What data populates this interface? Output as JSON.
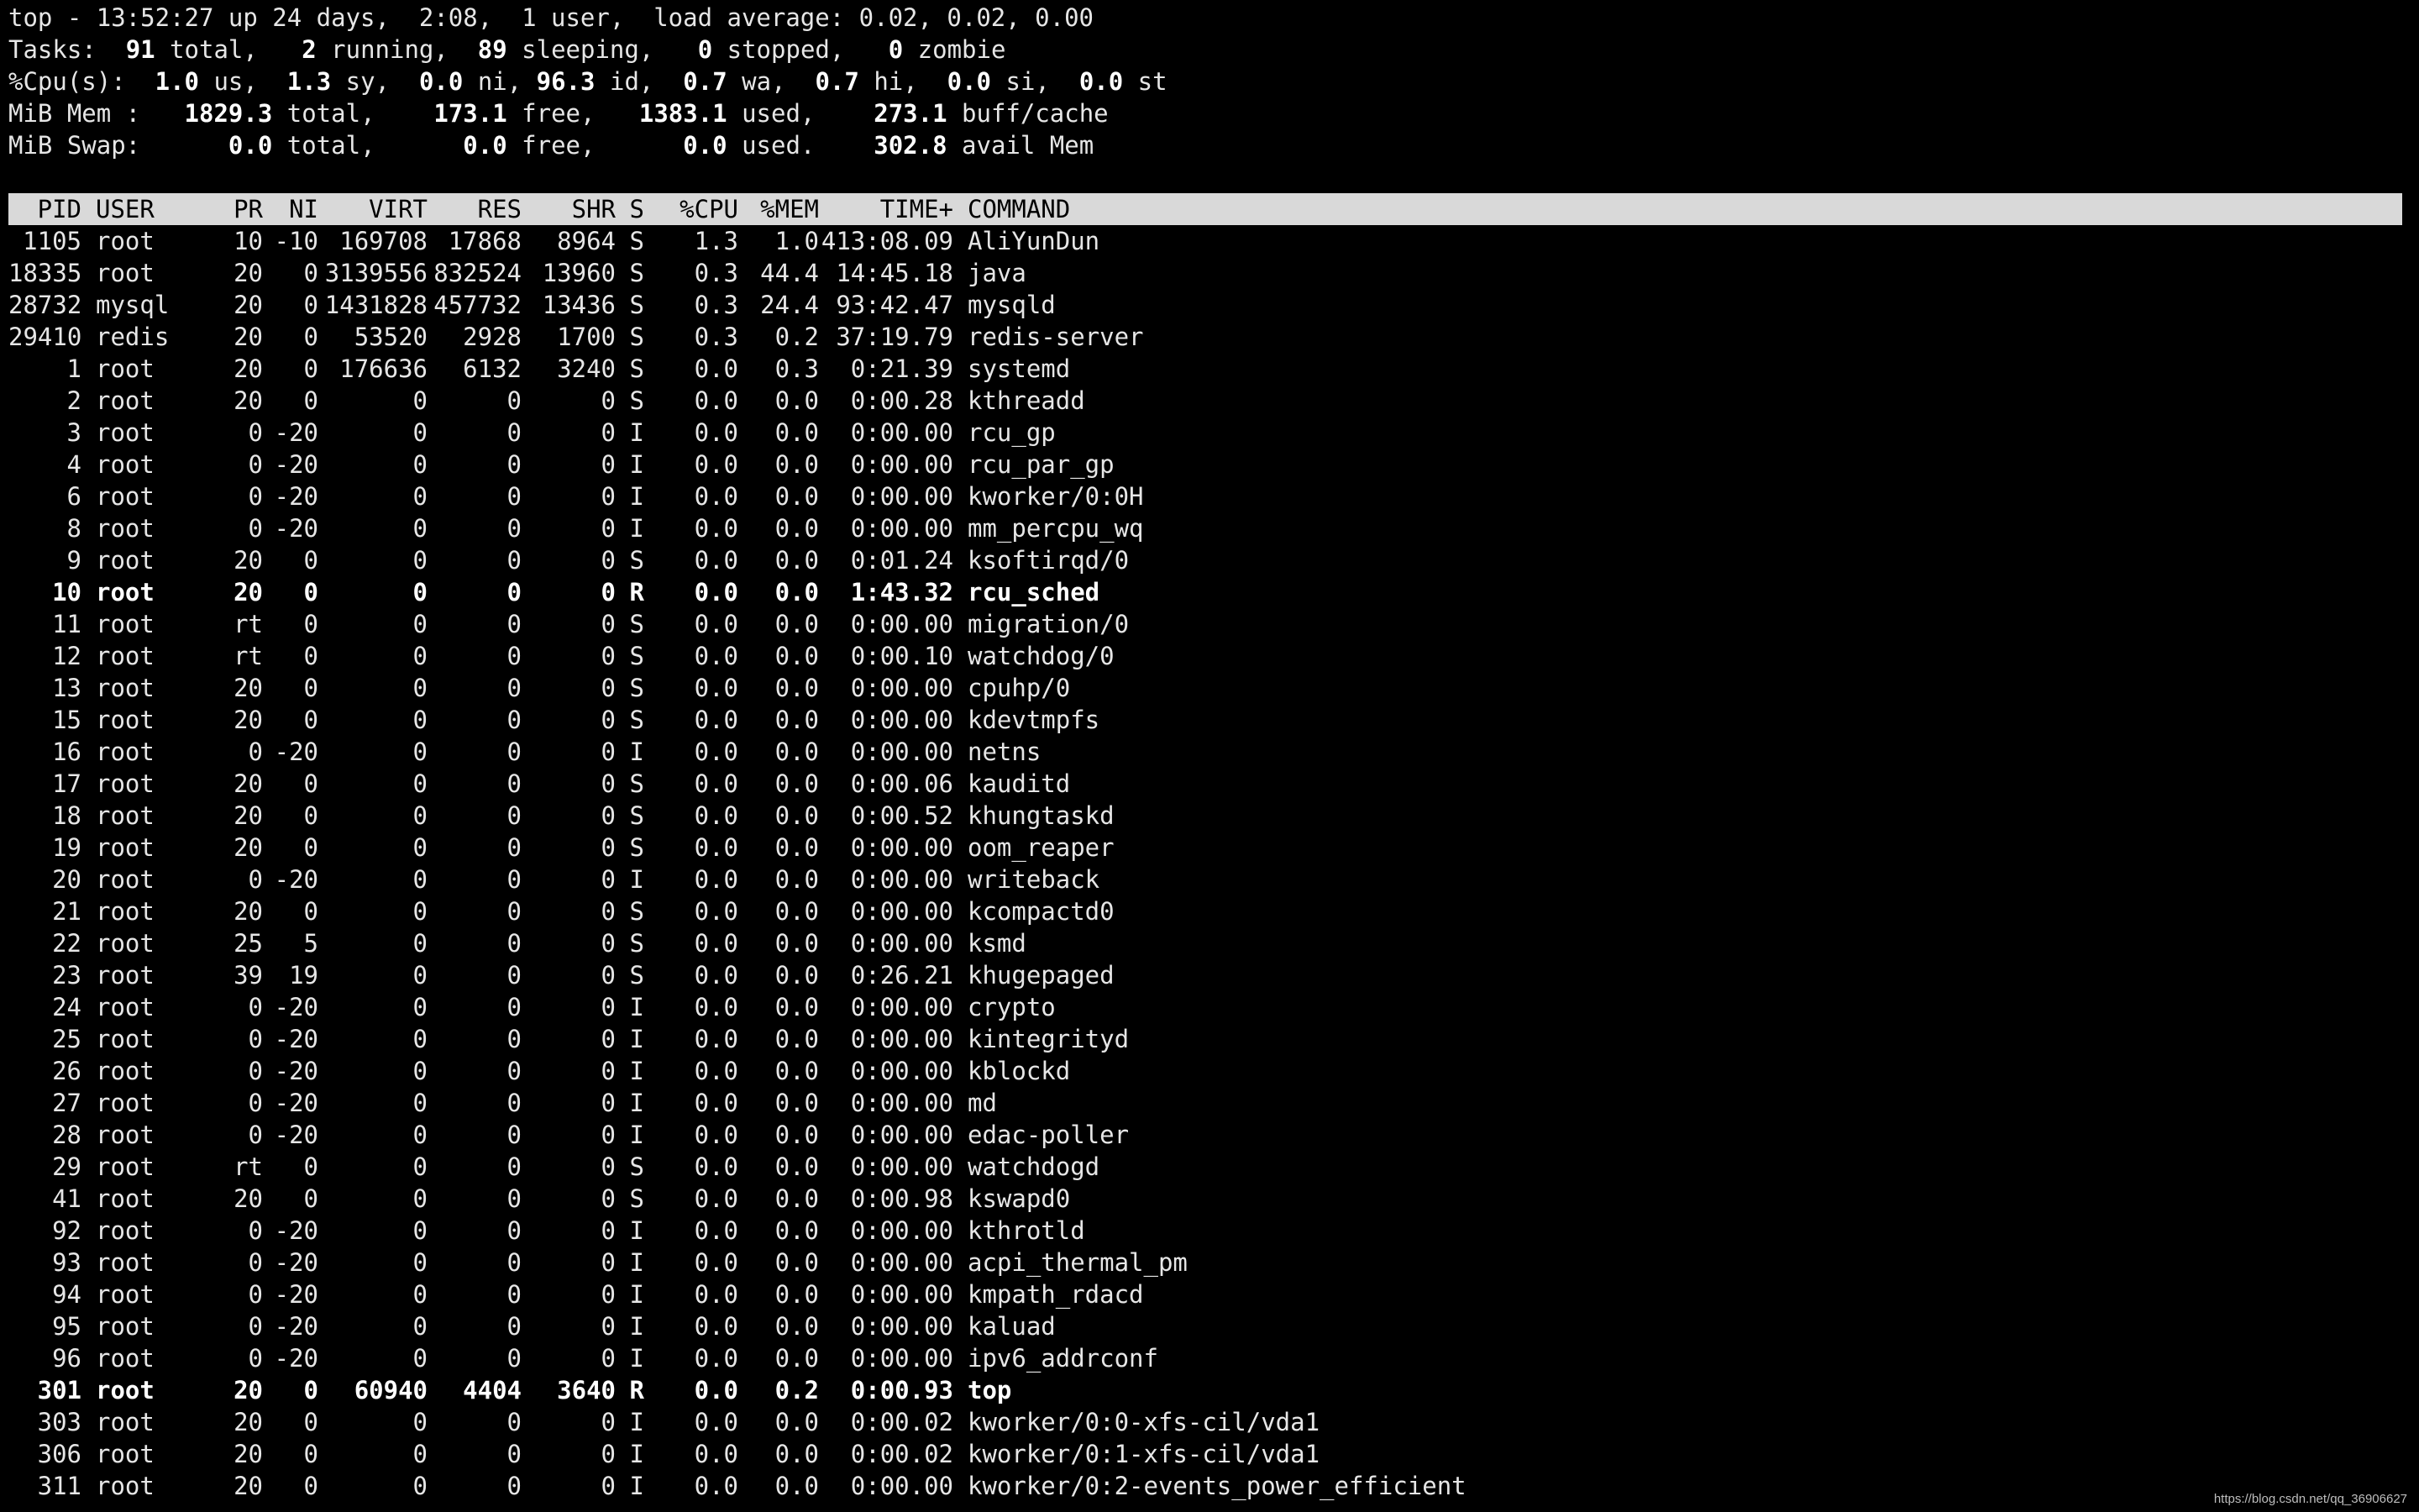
{
  "summary": {
    "uptime_line": "top - 13:52:27 up 24 days,  2:08,  1 user,  load average: 0.02, 0.02, 0.00",
    "tasks": {
      "label": "Tasks:",
      "total": "91",
      "total_label": "total,",
      "running": "2",
      "running_label": "running,",
      "sleeping": "89",
      "sleeping_label": "sleeping,",
      "stopped": "0",
      "stopped_label": "stopped,",
      "zombie": "0",
      "zombie_label": "zombie"
    },
    "cpu": {
      "label": "%Cpu(s):",
      "us": "1.0",
      "us_label": "us,",
      "sy": "1.3",
      "sy_label": "sy,",
      "ni": "0.0",
      "ni_label": "ni,",
      "id": "96.3",
      "id_label": "id,",
      "wa": "0.7",
      "wa_label": "wa,",
      "hi": "0.7",
      "hi_label": "hi,",
      "si": "0.0",
      "si_label": "si,",
      "st": "0.0",
      "st_label": "st"
    },
    "mem": {
      "label": "MiB Mem :",
      "total": "1829.3",
      "total_label": "total,",
      "free": "173.1",
      "free_label": "free,",
      "used": "1383.1",
      "used_label": "used,",
      "buff": "273.1",
      "buff_label": "buff/cache"
    },
    "swap": {
      "label": "MiB Swap:",
      "total": "0.0",
      "total_label": "total,",
      "free": "0.0",
      "free_label": "free,",
      "used": "0.0",
      "used_label": "used.",
      "avail": "302.8",
      "avail_label": "avail Mem"
    }
  },
  "table": {
    "columns": {
      "pid": "PID",
      "user": "USER",
      "pr": "PR",
      "ni": "NI",
      "virt": "VIRT",
      "res": "RES",
      "shr": "SHR",
      "s": "S",
      "cpu": "%CPU",
      "mem": "%MEM",
      "time": "TIME+",
      "command": "COMMAND"
    },
    "rows": [
      {
        "pid": "1105",
        "user": "root",
        "pr": "10",
        "ni": "-10",
        "virt": "169708",
        "res": "17868",
        "shr": "8964",
        "s": "S",
        "cpu": "1.3",
        "mem": "1.0",
        "time": "413:08.09",
        "command": "AliYunDun",
        "bold": false
      },
      {
        "pid": "18335",
        "user": "root",
        "pr": "20",
        "ni": "0",
        "virt": "3139556",
        "res": "832524",
        "shr": "13960",
        "s": "S",
        "cpu": "0.3",
        "mem": "44.4",
        "time": "14:45.18",
        "command": "java",
        "bold": false
      },
      {
        "pid": "28732",
        "user": "mysql",
        "pr": "20",
        "ni": "0",
        "virt": "1431828",
        "res": "457732",
        "shr": "13436",
        "s": "S",
        "cpu": "0.3",
        "mem": "24.4",
        "time": "93:42.47",
        "command": "mysqld",
        "bold": false
      },
      {
        "pid": "29410",
        "user": "redis",
        "pr": "20",
        "ni": "0",
        "virt": "53520",
        "res": "2928",
        "shr": "1700",
        "s": "S",
        "cpu": "0.3",
        "mem": "0.2",
        "time": "37:19.79",
        "command": "redis-server",
        "bold": false
      },
      {
        "pid": "1",
        "user": "root",
        "pr": "20",
        "ni": "0",
        "virt": "176636",
        "res": "6132",
        "shr": "3240",
        "s": "S",
        "cpu": "0.0",
        "mem": "0.3",
        "time": "0:21.39",
        "command": "systemd",
        "bold": false
      },
      {
        "pid": "2",
        "user": "root",
        "pr": "20",
        "ni": "0",
        "virt": "0",
        "res": "0",
        "shr": "0",
        "s": "S",
        "cpu": "0.0",
        "mem": "0.0",
        "time": "0:00.28",
        "command": "kthreadd",
        "bold": false
      },
      {
        "pid": "3",
        "user": "root",
        "pr": "0",
        "ni": "-20",
        "virt": "0",
        "res": "0",
        "shr": "0",
        "s": "I",
        "cpu": "0.0",
        "mem": "0.0",
        "time": "0:00.00",
        "command": "rcu_gp",
        "bold": false
      },
      {
        "pid": "4",
        "user": "root",
        "pr": "0",
        "ni": "-20",
        "virt": "0",
        "res": "0",
        "shr": "0",
        "s": "I",
        "cpu": "0.0",
        "mem": "0.0",
        "time": "0:00.00",
        "command": "rcu_par_gp",
        "bold": false
      },
      {
        "pid": "6",
        "user": "root",
        "pr": "0",
        "ni": "-20",
        "virt": "0",
        "res": "0",
        "shr": "0",
        "s": "I",
        "cpu": "0.0",
        "mem": "0.0",
        "time": "0:00.00",
        "command": "kworker/0:0H",
        "bold": false
      },
      {
        "pid": "8",
        "user": "root",
        "pr": "0",
        "ni": "-20",
        "virt": "0",
        "res": "0",
        "shr": "0",
        "s": "I",
        "cpu": "0.0",
        "mem": "0.0",
        "time": "0:00.00",
        "command": "mm_percpu_wq",
        "bold": false
      },
      {
        "pid": "9",
        "user": "root",
        "pr": "20",
        "ni": "0",
        "virt": "0",
        "res": "0",
        "shr": "0",
        "s": "S",
        "cpu": "0.0",
        "mem": "0.0",
        "time": "0:01.24",
        "command": "ksoftirqd/0",
        "bold": false
      },
      {
        "pid": "10",
        "user": "root",
        "pr": "20",
        "ni": "0",
        "virt": "0",
        "res": "0",
        "shr": "0",
        "s": "R",
        "cpu": "0.0",
        "mem": "0.0",
        "time": "1:43.32",
        "command": "rcu_sched",
        "bold": true
      },
      {
        "pid": "11",
        "user": "root",
        "pr": "rt",
        "ni": "0",
        "virt": "0",
        "res": "0",
        "shr": "0",
        "s": "S",
        "cpu": "0.0",
        "mem": "0.0",
        "time": "0:00.00",
        "command": "migration/0",
        "bold": false
      },
      {
        "pid": "12",
        "user": "root",
        "pr": "rt",
        "ni": "0",
        "virt": "0",
        "res": "0",
        "shr": "0",
        "s": "S",
        "cpu": "0.0",
        "mem": "0.0",
        "time": "0:00.10",
        "command": "watchdog/0",
        "bold": false
      },
      {
        "pid": "13",
        "user": "root",
        "pr": "20",
        "ni": "0",
        "virt": "0",
        "res": "0",
        "shr": "0",
        "s": "S",
        "cpu": "0.0",
        "mem": "0.0",
        "time": "0:00.00",
        "command": "cpuhp/0",
        "bold": false
      },
      {
        "pid": "15",
        "user": "root",
        "pr": "20",
        "ni": "0",
        "virt": "0",
        "res": "0",
        "shr": "0",
        "s": "S",
        "cpu": "0.0",
        "mem": "0.0",
        "time": "0:00.00",
        "command": "kdevtmpfs",
        "bold": false
      },
      {
        "pid": "16",
        "user": "root",
        "pr": "0",
        "ni": "-20",
        "virt": "0",
        "res": "0",
        "shr": "0",
        "s": "I",
        "cpu": "0.0",
        "mem": "0.0",
        "time": "0:00.00",
        "command": "netns",
        "bold": false
      },
      {
        "pid": "17",
        "user": "root",
        "pr": "20",
        "ni": "0",
        "virt": "0",
        "res": "0",
        "shr": "0",
        "s": "S",
        "cpu": "0.0",
        "mem": "0.0",
        "time": "0:00.06",
        "command": "kauditd",
        "bold": false
      },
      {
        "pid": "18",
        "user": "root",
        "pr": "20",
        "ni": "0",
        "virt": "0",
        "res": "0",
        "shr": "0",
        "s": "S",
        "cpu": "0.0",
        "mem": "0.0",
        "time": "0:00.52",
        "command": "khungtaskd",
        "bold": false
      },
      {
        "pid": "19",
        "user": "root",
        "pr": "20",
        "ni": "0",
        "virt": "0",
        "res": "0",
        "shr": "0",
        "s": "S",
        "cpu": "0.0",
        "mem": "0.0",
        "time": "0:00.00",
        "command": "oom_reaper",
        "bold": false
      },
      {
        "pid": "20",
        "user": "root",
        "pr": "0",
        "ni": "-20",
        "virt": "0",
        "res": "0",
        "shr": "0",
        "s": "I",
        "cpu": "0.0",
        "mem": "0.0",
        "time": "0:00.00",
        "command": "writeback",
        "bold": false
      },
      {
        "pid": "21",
        "user": "root",
        "pr": "20",
        "ni": "0",
        "virt": "0",
        "res": "0",
        "shr": "0",
        "s": "S",
        "cpu": "0.0",
        "mem": "0.0",
        "time": "0:00.00",
        "command": "kcompactd0",
        "bold": false
      },
      {
        "pid": "22",
        "user": "root",
        "pr": "25",
        "ni": "5",
        "virt": "0",
        "res": "0",
        "shr": "0",
        "s": "S",
        "cpu": "0.0",
        "mem": "0.0",
        "time": "0:00.00",
        "command": "ksmd",
        "bold": false
      },
      {
        "pid": "23",
        "user": "root",
        "pr": "39",
        "ni": "19",
        "virt": "0",
        "res": "0",
        "shr": "0",
        "s": "S",
        "cpu": "0.0",
        "mem": "0.0",
        "time": "0:26.21",
        "command": "khugepaged",
        "bold": false
      },
      {
        "pid": "24",
        "user": "root",
        "pr": "0",
        "ni": "-20",
        "virt": "0",
        "res": "0",
        "shr": "0",
        "s": "I",
        "cpu": "0.0",
        "mem": "0.0",
        "time": "0:00.00",
        "command": "crypto",
        "bold": false
      },
      {
        "pid": "25",
        "user": "root",
        "pr": "0",
        "ni": "-20",
        "virt": "0",
        "res": "0",
        "shr": "0",
        "s": "I",
        "cpu": "0.0",
        "mem": "0.0",
        "time": "0:00.00",
        "command": "kintegrityd",
        "bold": false
      },
      {
        "pid": "26",
        "user": "root",
        "pr": "0",
        "ni": "-20",
        "virt": "0",
        "res": "0",
        "shr": "0",
        "s": "I",
        "cpu": "0.0",
        "mem": "0.0",
        "time": "0:00.00",
        "command": "kblockd",
        "bold": false
      },
      {
        "pid": "27",
        "user": "root",
        "pr": "0",
        "ni": "-20",
        "virt": "0",
        "res": "0",
        "shr": "0",
        "s": "I",
        "cpu": "0.0",
        "mem": "0.0",
        "time": "0:00.00",
        "command": "md",
        "bold": false
      },
      {
        "pid": "28",
        "user": "root",
        "pr": "0",
        "ni": "-20",
        "virt": "0",
        "res": "0",
        "shr": "0",
        "s": "I",
        "cpu": "0.0",
        "mem": "0.0",
        "time": "0:00.00",
        "command": "edac-poller",
        "bold": false
      },
      {
        "pid": "29",
        "user": "root",
        "pr": "rt",
        "ni": "0",
        "virt": "0",
        "res": "0",
        "shr": "0",
        "s": "S",
        "cpu": "0.0",
        "mem": "0.0",
        "time": "0:00.00",
        "command": "watchdogd",
        "bold": false
      },
      {
        "pid": "41",
        "user": "root",
        "pr": "20",
        "ni": "0",
        "virt": "0",
        "res": "0",
        "shr": "0",
        "s": "S",
        "cpu": "0.0",
        "mem": "0.0",
        "time": "0:00.98",
        "command": "kswapd0",
        "bold": false
      },
      {
        "pid": "92",
        "user": "root",
        "pr": "0",
        "ni": "-20",
        "virt": "0",
        "res": "0",
        "shr": "0",
        "s": "I",
        "cpu": "0.0",
        "mem": "0.0",
        "time": "0:00.00",
        "command": "kthrotld",
        "bold": false
      },
      {
        "pid": "93",
        "user": "root",
        "pr": "0",
        "ni": "-20",
        "virt": "0",
        "res": "0",
        "shr": "0",
        "s": "I",
        "cpu": "0.0",
        "mem": "0.0",
        "time": "0:00.00",
        "command": "acpi_thermal_pm",
        "bold": false
      },
      {
        "pid": "94",
        "user": "root",
        "pr": "0",
        "ni": "-20",
        "virt": "0",
        "res": "0",
        "shr": "0",
        "s": "I",
        "cpu": "0.0",
        "mem": "0.0",
        "time": "0:00.00",
        "command": "kmpath_rdacd",
        "bold": false
      },
      {
        "pid": "95",
        "user": "root",
        "pr": "0",
        "ni": "-20",
        "virt": "0",
        "res": "0",
        "shr": "0",
        "s": "I",
        "cpu": "0.0",
        "mem": "0.0",
        "time": "0:00.00",
        "command": "kaluad",
        "bold": false
      },
      {
        "pid": "96",
        "user": "root",
        "pr": "0",
        "ni": "-20",
        "virt": "0",
        "res": "0",
        "shr": "0",
        "s": "I",
        "cpu": "0.0",
        "mem": "0.0",
        "time": "0:00.00",
        "command": "ipv6_addrconf",
        "bold": false
      },
      {
        "pid": "301",
        "user": "root",
        "pr": "20",
        "ni": "0",
        "virt": "60940",
        "res": "4404",
        "shr": "3640",
        "s": "R",
        "cpu": "0.0",
        "mem": "0.2",
        "time": "0:00.93",
        "command": "top",
        "bold": true
      },
      {
        "pid": "303",
        "user": "root",
        "pr": "20",
        "ni": "0",
        "virt": "0",
        "res": "0",
        "shr": "0",
        "s": "I",
        "cpu": "0.0",
        "mem": "0.0",
        "time": "0:00.02",
        "command": "kworker/0:0-xfs-cil/vda1",
        "bold": false
      },
      {
        "pid": "306",
        "user": "root",
        "pr": "20",
        "ni": "0",
        "virt": "0",
        "res": "0",
        "shr": "0",
        "s": "I",
        "cpu": "0.0",
        "mem": "0.0",
        "time": "0:00.02",
        "command": "kworker/0:1-xfs-cil/vda1",
        "bold": false
      },
      {
        "pid": "311",
        "user": "root",
        "pr": "20",
        "ni": "0",
        "virt": "0",
        "res": "0",
        "shr": "0",
        "s": "I",
        "cpu": "0.0",
        "mem": "0.0",
        "time": "0:00.00",
        "command": "kworker/0:2-events_power_efficient",
        "bold": false
      }
    ]
  },
  "watermark": "https://blog.csdn.net/qq_36906627"
}
